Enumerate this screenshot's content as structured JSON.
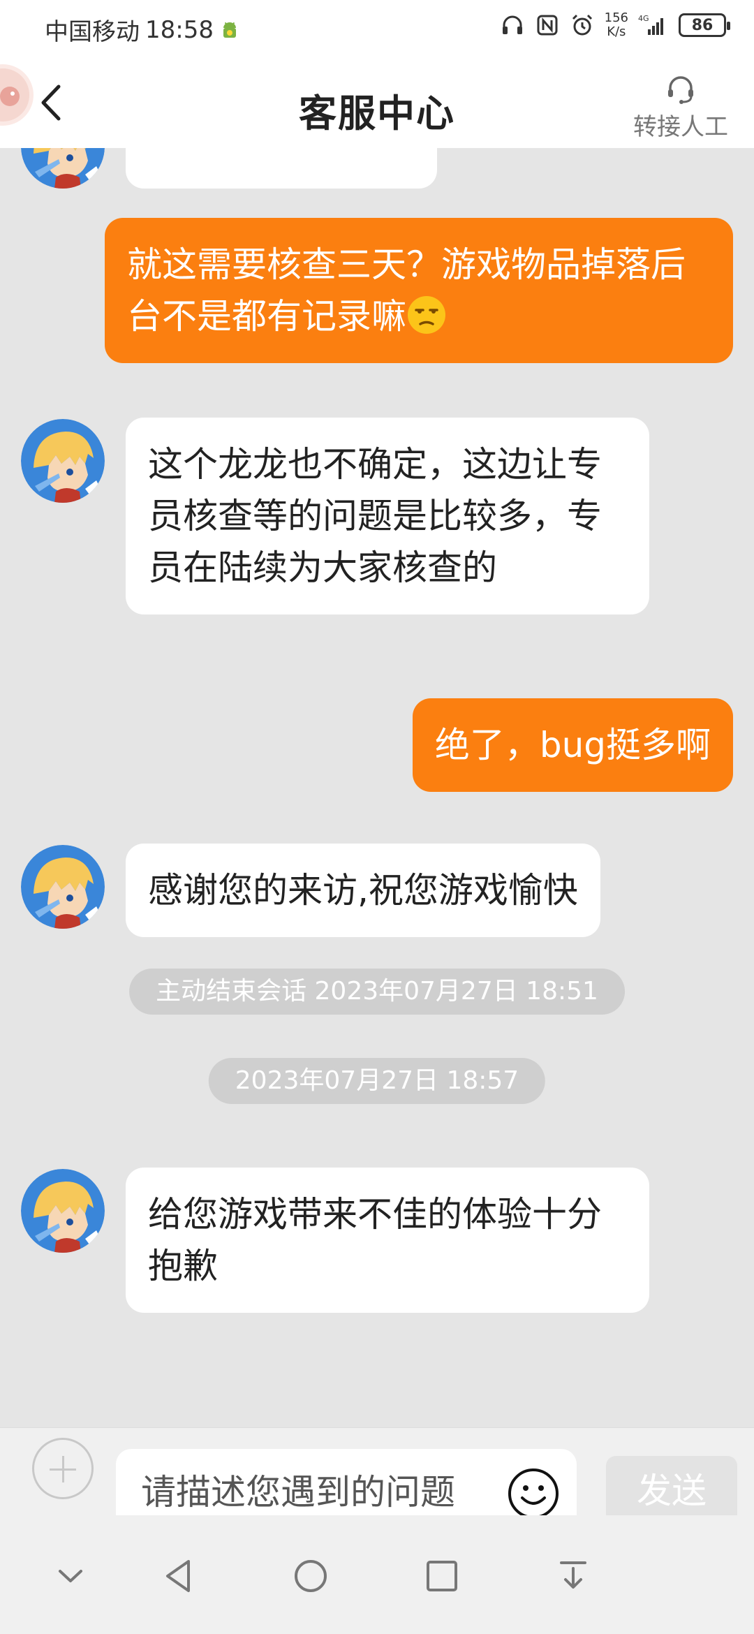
{
  "status_bar": {
    "carrier": "中国移动",
    "time": "18:58",
    "speed_value": "156",
    "speed_unit": "K/s",
    "battery": "86"
  },
  "header": {
    "title": "客服中心",
    "transfer_label": "转接人工"
  },
  "messages": [
    {
      "from": "agent",
      "text": "这个龙龙也不确定，这边让专员核查等的问题是比较多，专员在陆续为大家核查的"
    },
    {
      "from": "user",
      "text": "就这需要核查三天？游戏物品掉落后台不是都有记录嘛",
      "emoji": "unamused-face"
    },
    {
      "from": "user",
      "text": "绝了，bug挺多啊"
    },
    {
      "from": "agent",
      "text": "感谢您的来访,祝您游戏愉快"
    },
    {
      "from": "agent",
      "text": "给您游戏带来不佳的体验十分抱歉"
    }
  ],
  "system_notes": [
    "主动结束会话 2023年07月27日 18:51",
    "2023年07月27日 18:57"
  ],
  "input": {
    "placeholder": "请描述您遇到的问题",
    "send_label": "发送"
  },
  "colors": {
    "accent": "#fb7f10",
    "background": "#e5e5e5",
    "timestamp_pill": "#cfcfcf"
  }
}
